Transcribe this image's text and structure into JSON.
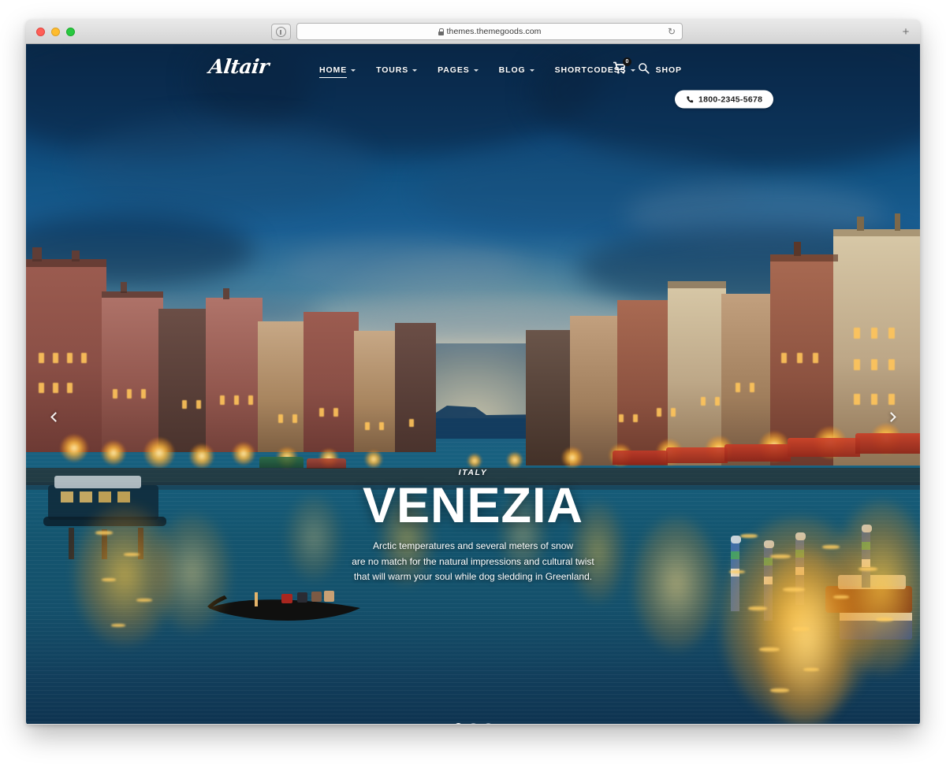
{
  "browser": {
    "url": "themes.themegoods.com",
    "lock_icon": "padlock-icon",
    "reader_icon": "reader-view-icon",
    "reload_icon": "↻",
    "newtab_icon": "+",
    "traffic_lights": [
      "close",
      "minimize",
      "maximize"
    ],
    "colors": {
      "close": "#ff5f57",
      "minimize": "#febc2e",
      "maximize": "#28c840"
    }
  },
  "site": {
    "logo": "Altair",
    "nav": [
      {
        "label": "HOME",
        "caret": true,
        "active": true
      },
      {
        "label": "TOURS",
        "caret": true,
        "active": false
      },
      {
        "label": "PAGES",
        "caret": true,
        "active": false
      },
      {
        "label": "BLOG",
        "caret": true,
        "active": false
      },
      {
        "label": "SHORTCODESS",
        "caret": true,
        "active": false
      },
      {
        "label": "SHOP",
        "caret": false,
        "active": false
      }
    ],
    "tools": {
      "cart_icon": "shopping-cart-icon",
      "cart_count": "0",
      "search_icon": "search-icon"
    },
    "phone": {
      "icon": "phone-icon",
      "number": "1800-2345-5678"
    }
  },
  "hero": {
    "eyebrow": "ITALY",
    "title": "VENEZIA",
    "description_lines": [
      "Arctic temperatures and several meters of snow",
      "are no match for the natural impressions and cultural twist",
      "that will warm your soul while dog sledding in Greenland."
    ],
    "prev_icon": "chevron-left-icon",
    "next_icon": "chevron-right-icon",
    "slides": [
      {
        "active": true
      },
      {
        "active": false
      },
      {
        "active": false
      }
    ]
  },
  "theme": {
    "sky_top": "#0a2c4e",
    "sky_mid": "#125383",
    "horizon": "#e9d9b4",
    "water": "#14556f",
    "gold": "#ffc43c",
    "accent_white": "#ffffff"
  }
}
